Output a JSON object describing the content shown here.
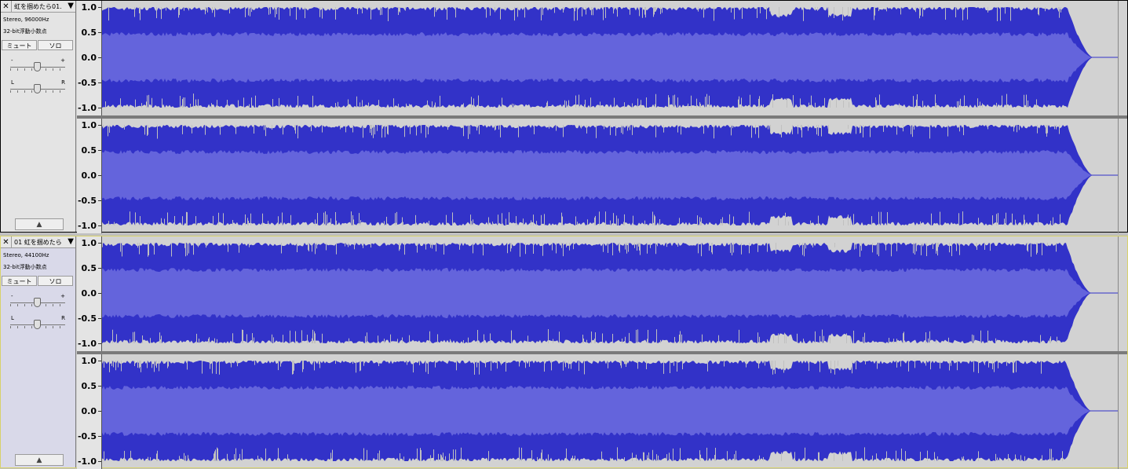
{
  "tracks": [
    {
      "name": "虹を掴めたら01.",
      "format": "Stereo, 96000Hz",
      "bitdepth": "32-bit浮動小数点",
      "mute_label": "ミュート",
      "solo_label": "ソロ",
      "gain_minus": "-",
      "gain_plus": "+",
      "pan_left": "L",
      "pan_right": "R"
    },
    {
      "name": "01 虹を掴めたら",
      "format": "Stereo, 44100Hz",
      "bitdepth": "32-bit浮動小数点",
      "mute_label": "ミュート",
      "solo_label": "ソロ",
      "gain_minus": "-",
      "gain_plus": "+",
      "pan_left": "L",
      "pan_right": "R"
    }
  ],
  "scale_labels": [
    "1.0",
    "0.5",
    "0.0",
    "-0.5",
    "-1.0"
  ],
  "icons": {
    "close": "close-icon",
    "dropdown": "chevron-down-icon",
    "collapse": "collapse-up-icon"
  },
  "colors": {
    "wave_peak": "#3232c8",
    "wave_rms": "#6464dc",
    "background": "#c0c0c0",
    "selected_border": "#d8d26a"
  }
}
